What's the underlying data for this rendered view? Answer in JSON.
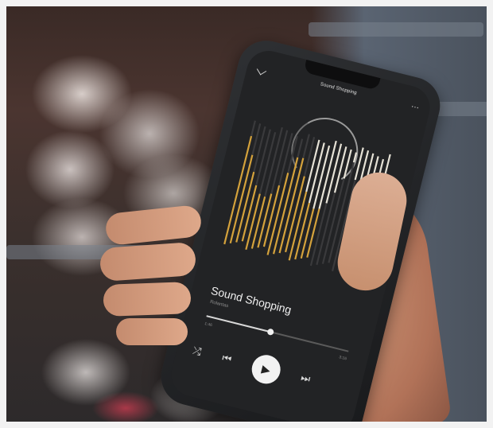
{
  "screen": {
    "top_title": "Sound Shopping",
    "track_title": "Sound Shopping",
    "artist": "Rolantas",
    "time_elapsed": "1:46",
    "time_total": "3:16",
    "progress": 0.45
  },
  "icons": {
    "back": "chevron-down-icon",
    "more": "more-dots-icon",
    "shuffle": "shuffle-icon",
    "previous": "skip-previous-icon",
    "play": "play-icon",
    "next": "skip-next-icon"
  },
  "colors": {
    "screen_bg": "#222325",
    "bar_gold": "#d4a23c",
    "bar_light": "#e6e2d6",
    "bar_dark": "#3a3a3c"
  }
}
